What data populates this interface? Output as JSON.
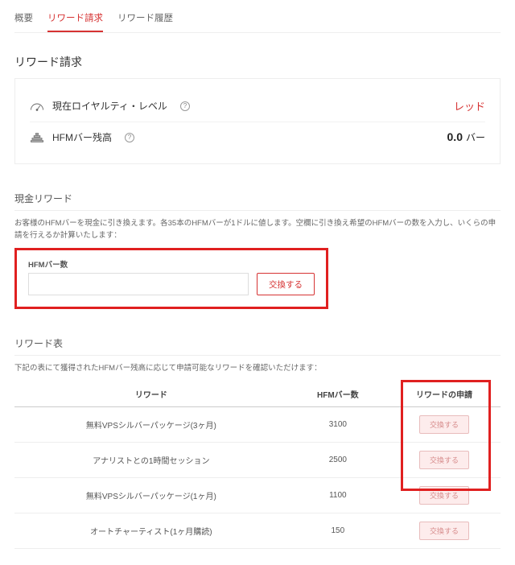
{
  "tabs": {
    "overview": "概要",
    "claim": "リワード請求",
    "history": "リワード履歴"
  },
  "claim_title": "リワード請求",
  "loyalty": {
    "label": "現在ロイヤルティ・レベル",
    "value": "レッド"
  },
  "balance": {
    "label": "HFMバー残高",
    "value": "0.0",
    "unit": "バー"
  },
  "cash_reward": {
    "title": "現金リワード",
    "desc": "お客様のHFMバーを現金に引き換えます。各35本のHFMバーが1ドルに値します。空欄に引き換え希望のHFMバーの数を入力し、いくらの申請を行えるか計算いたします：",
    "field_label": "HFMバー数",
    "exchange_btn": "交換する"
  },
  "reward_table": {
    "title": "リワード表",
    "desc": "下記の表にて獲得されたHFMバー残高に応じて申請可能なリワードを確認いただけます：",
    "headers": {
      "reward": "リワード",
      "bars": "HFMバー数",
      "claim": "リワードの申請"
    },
    "rows": [
      {
        "name": "無料VPSシルバーパッケージ(3ヶ月)",
        "bars": "3100",
        "btn": "交換する"
      },
      {
        "name": "アナリストとの1時間セッション",
        "bars": "2500",
        "btn": "交換する"
      },
      {
        "name": "無料VPSシルバーパッケージ(1ヶ月)",
        "bars": "1100",
        "btn": "交換する"
      },
      {
        "name": "オートチャーティスト(1ヶ月購読)",
        "bars": "150",
        "btn": "交換する"
      }
    ]
  }
}
